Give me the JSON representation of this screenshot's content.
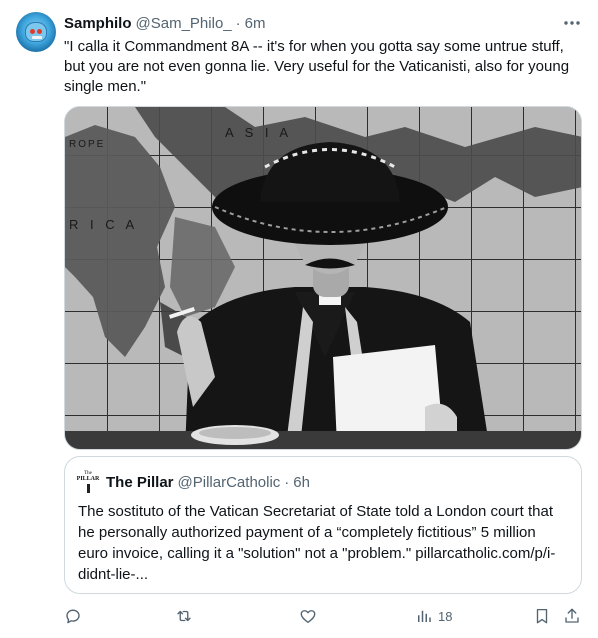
{
  "tweet": {
    "author_name": "Samphilo",
    "author_handle": "@Sam_Philo_",
    "separator": "·",
    "time": "6m",
    "text": "\"I calla it Commandment 8A -- it's for when you gotta say some untrue stuff, but you are not even gonna lie. Very useful for the Vaticanisti, also for young single men.\""
  },
  "media": {
    "map_labels": [
      "ROPE",
      "A S I A",
      "R I C A"
    ]
  },
  "quote": {
    "author_name": "The Pillar",
    "author_handle": "@PillarCatholic",
    "separator": "·",
    "time": "6h",
    "logo_text_top": "The",
    "logo_text_bottom": "PILLAR",
    "text": "The sostituto of the Vatican Secretariat of State told a London court that he personally authorized payment of a “completely fictitious” 5 million euro invoice, calling it a \"solution\" not a \"problem.\" pillarcatholic.com/p/i-didnt-lie-..."
  },
  "actions": {
    "views_count": "18"
  },
  "icons": {
    "more": "more-horizontal-icon",
    "reply": "reply-icon",
    "retweet": "retweet-icon",
    "like": "like-icon",
    "views": "views-icon",
    "bookmark": "bookmark-icon",
    "share": "share-icon"
  }
}
